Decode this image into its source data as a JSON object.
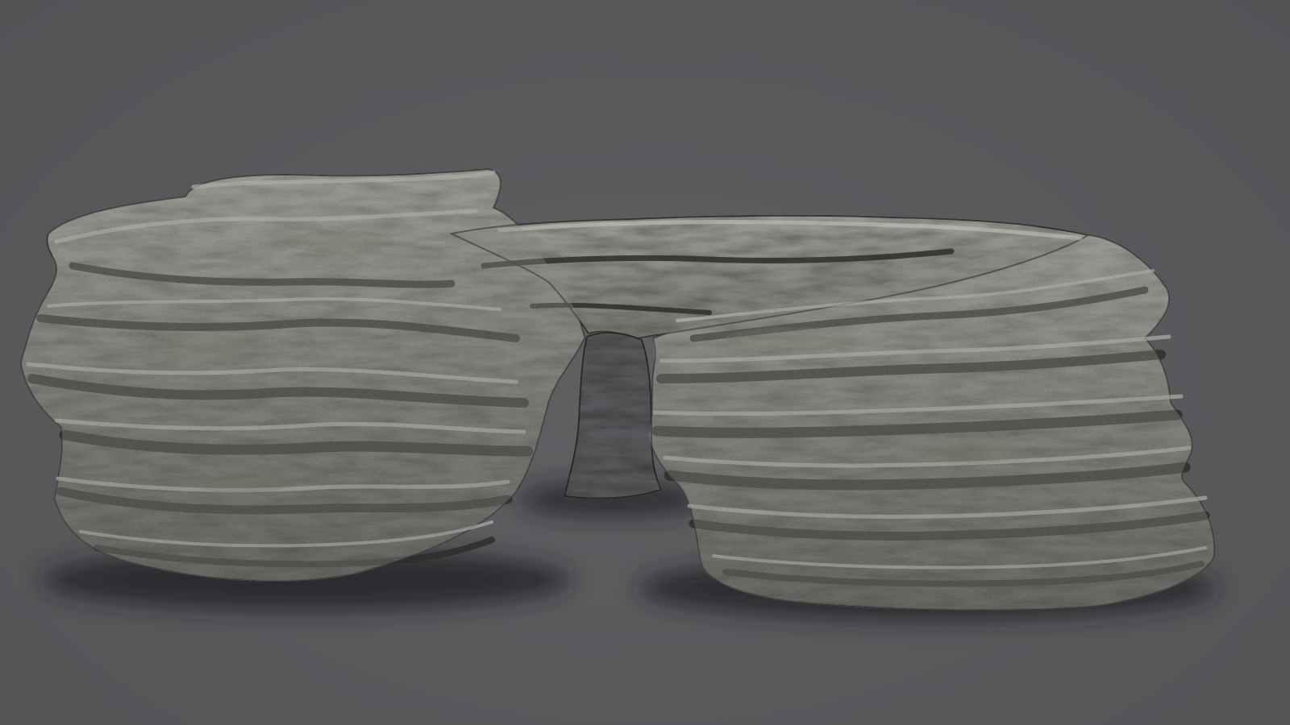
{
  "scene": {
    "subject": "rock-arch-3d-model",
    "colors": {
      "background": "#59595c",
      "shadow": "#1e1e21",
      "rock_light": "#9c9a95",
      "rock_mid": "#76746f",
      "rock_dark": "#3c3b39",
      "rock_highlight": "#c9c7c1",
      "moss": "#6b7052"
    }
  }
}
